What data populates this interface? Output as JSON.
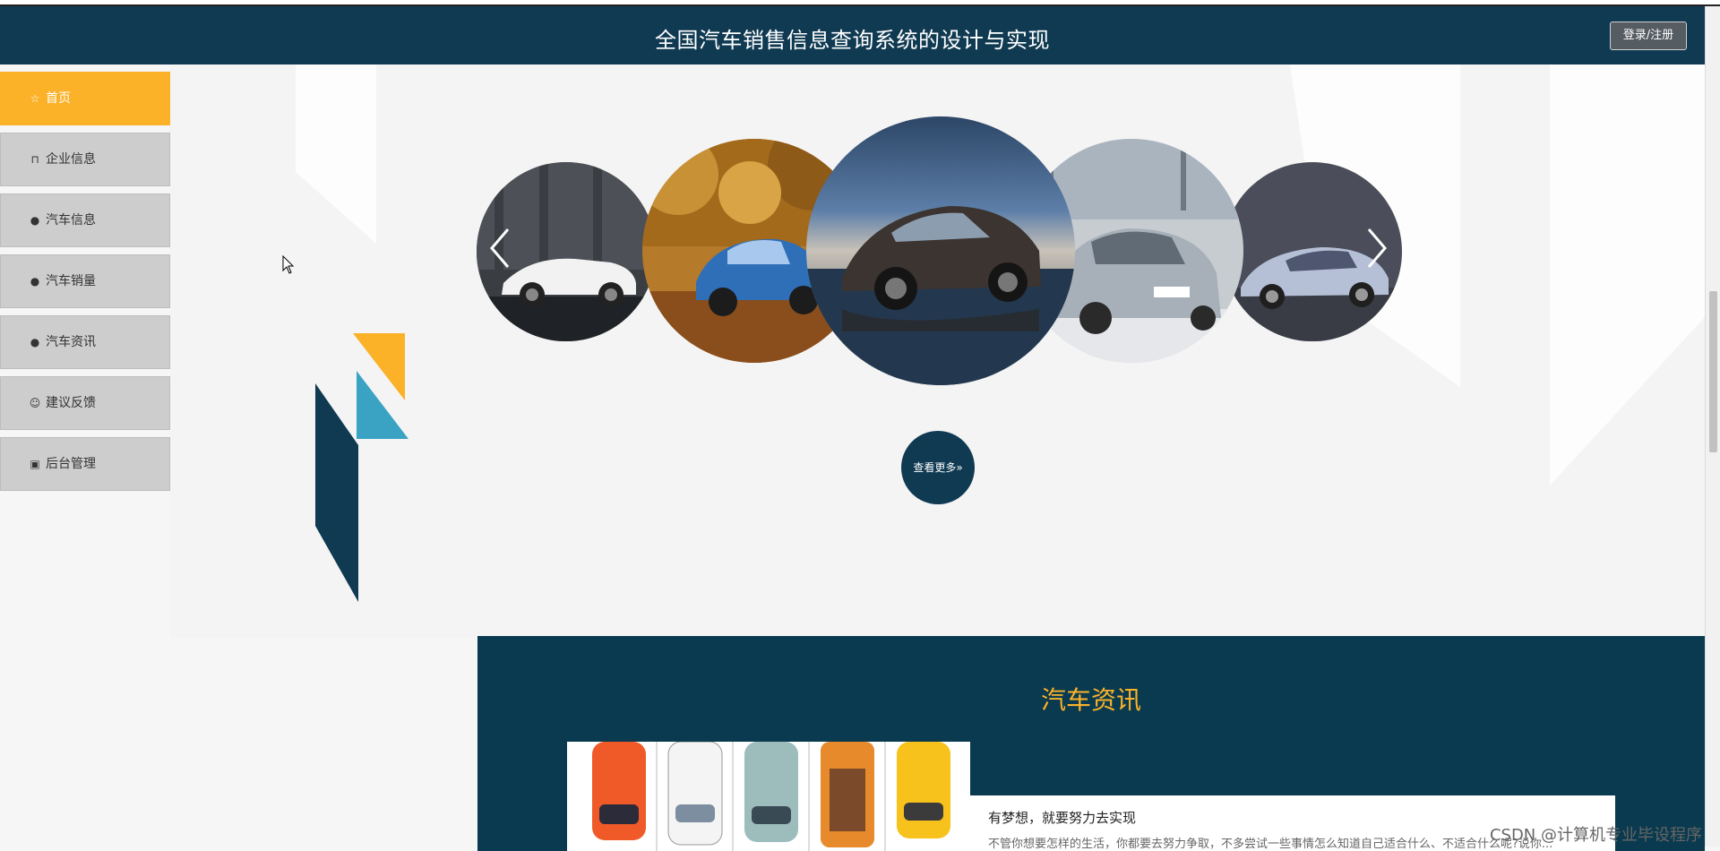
{
  "header": {
    "title": "全国汽车销售信息查询系统的设计与实现",
    "login_label": "登录/注册"
  },
  "sidebar": {
    "items": [
      {
        "label": "首页",
        "icon": "star-icon",
        "active": true
      },
      {
        "label": "企业信息",
        "icon": "lock-icon",
        "active": false
      },
      {
        "label": "汽车信息",
        "icon": "exclamation-circle-icon",
        "active": false
      },
      {
        "label": "汽车销量",
        "icon": "question-circle-icon",
        "active": false
      },
      {
        "label": "汽车资讯",
        "icon": "info-circle-icon",
        "active": false
      },
      {
        "label": "建议反馈",
        "icon": "smile-icon",
        "active": false
      },
      {
        "label": "后台管理",
        "icon": "briefcase-icon",
        "active": false
      }
    ]
  },
  "carousel": {
    "slides": [
      {
        "name": "white convertible car"
      },
      {
        "name": "blue sports car in autumn forest"
      },
      {
        "name": "dark sedan on reflective water"
      },
      {
        "name": "silver sedan"
      },
      {
        "name": "silver supercar"
      }
    ],
    "more_label": "查看更多»"
  },
  "news": {
    "section_title": "汽车资讯",
    "item_title": "有梦想，就要努力去实现",
    "item_desc": "不管你想要怎样的生活，你都要去努力争取，不多尝试一些事情怎么知道自己适合什么、不适合什么呢?说你..."
  },
  "watermark": "CSDN @计算机专业毕设程序",
  "colors": {
    "header_bg": "#0f3a52",
    "accent": "#fbb229",
    "news_bg": "#0a3a4f",
    "teal": "#3aa3c4"
  }
}
